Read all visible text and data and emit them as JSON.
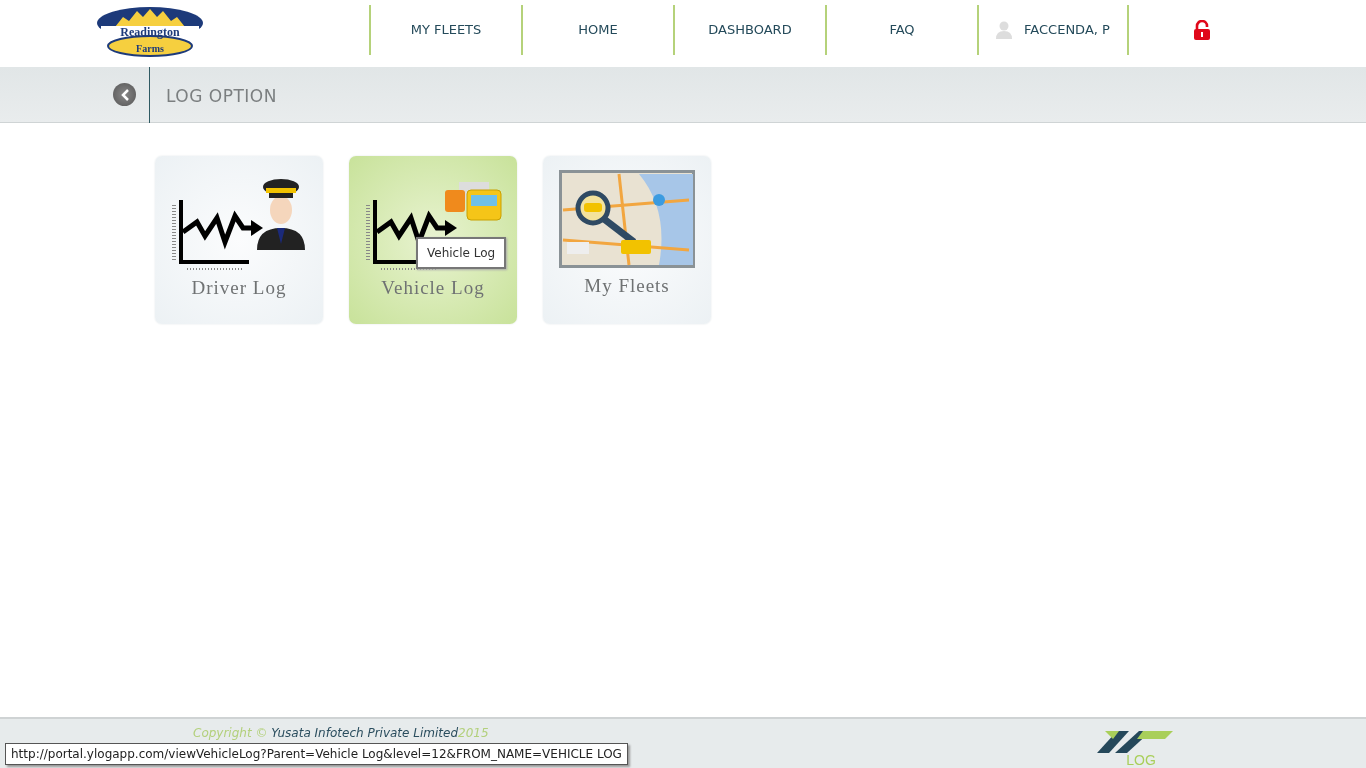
{
  "logo": {
    "top_text": "Readington",
    "bottom_text": "Farms"
  },
  "nav": [
    {
      "label": "MY FLEETS",
      "kind": "link"
    },
    {
      "label": "HOME",
      "kind": "link"
    },
    {
      "label": "DASHBOARD",
      "kind": "link"
    },
    {
      "label": "FAQ",
      "kind": "link"
    },
    {
      "label": "FACCENDA, P",
      "kind": "user"
    }
  ],
  "page_title": "LOG OPTION",
  "tiles": [
    {
      "label": "Driver Log",
      "kind": "driver",
      "selected": false
    },
    {
      "label": "Vehicle Log",
      "kind": "vehicle",
      "selected": true
    },
    {
      "label": "My Fleets",
      "kind": "map",
      "selected": false
    }
  ],
  "tooltip": "Vehicle Log",
  "footer": {
    "copyright": "Copyright ©",
    "company": "Yusata Infotech Private Limited",
    "year": "2015",
    "brand_text": "LOG"
  },
  "status_url": "http://portal.ylogapp.com/viewVehicleLog?Parent=Vehicle Log&level=12&FROM_NAME=VEHICLE LOG"
}
